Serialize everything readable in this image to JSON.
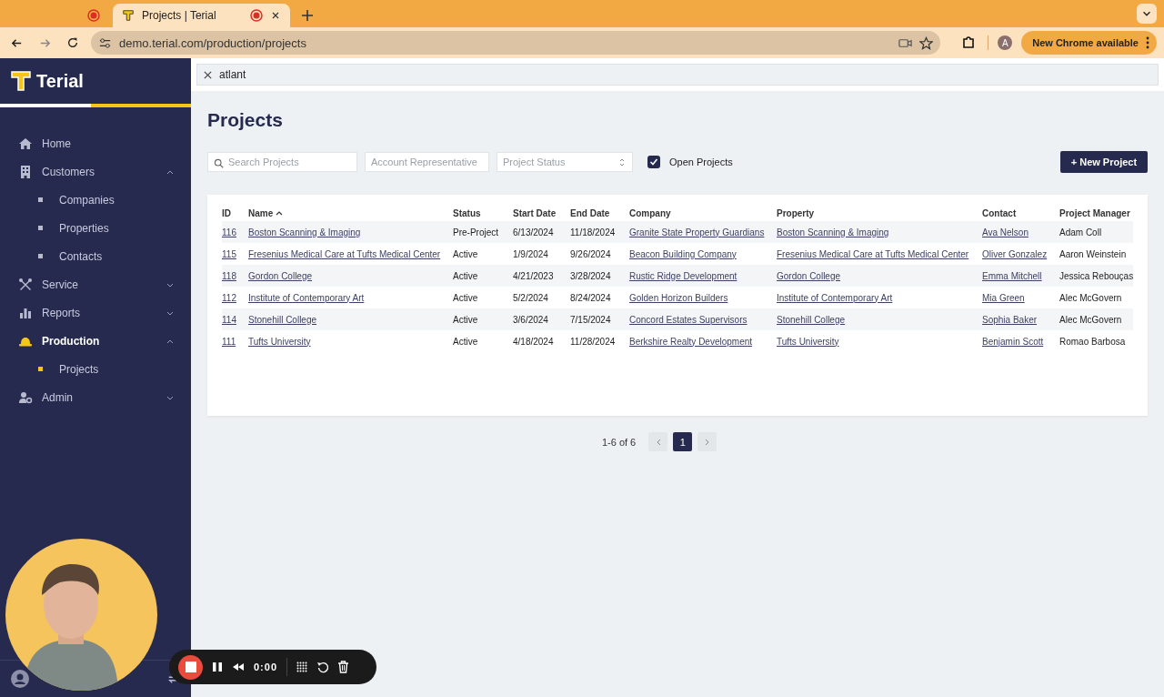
{
  "browser": {
    "tabs": [
      {
        "recording": true,
        "selected": false
      },
      {
        "title": "Projects | Terial",
        "recording": true,
        "selected": true
      }
    ],
    "url": "demo.terial.com/production/projects",
    "profile": "A",
    "update_button": "New Chrome available"
  },
  "sidebar": {
    "logo": "Terial",
    "items": [
      {
        "label": "Home",
        "selected": false
      },
      {
        "label": "Customers",
        "selected": false,
        "expanded": true,
        "children": [
          {
            "label": "Companies",
            "selected": false
          },
          {
            "label": "Properties",
            "selected": false
          },
          {
            "label": "Contacts",
            "selected": false
          }
        ]
      },
      {
        "label": "Service",
        "selected": false,
        "expanded": false
      },
      {
        "label": "Reports",
        "selected": false,
        "expanded": false
      },
      {
        "label": "Production",
        "selected": true,
        "expanded": true,
        "children": [
          {
            "label": "Projects",
            "selected": true
          }
        ]
      },
      {
        "label": "Admin",
        "selected": false,
        "expanded": false
      }
    ]
  },
  "global_search": {
    "value": "atlant"
  },
  "page_title": "Projects",
  "filters": {
    "search_placeholder": "Search Projects",
    "representative_placeholder": "Account Representative",
    "status_placeholder": "Project Status",
    "open_projects": {
      "label": "Open Projects",
      "checked": true
    },
    "new_button": "+ New Project"
  },
  "table": {
    "columns": [
      {
        "label": "ID",
        "sorted": false
      },
      {
        "label": "Name",
        "sorted": true
      },
      {
        "label": "Status",
        "sorted": false
      },
      {
        "label": "Start Date",
        "sorted": false
      },
      {
        "label": "End Date",
        "sorted": false
      },
      {
        "label": "Company",
        "sorted": false
      },
      {
        "label": "Property",
        "sorted": false
      },
      {
        "label": "Contact",
        "sorted": false
      },
      {
        "label": "Project Manager",
        "sorted": false
      }
    ],
    "rows": [
      {
        "id": "116",
        "name": "Boston Scanning & Imaging",
        "status": "Pre-Project",
        "start": "6/13/2024",
        "end": "11/18/2024",
        "company": "Granite State Property Guardians",
        "property": "Boston Scanning & Imaging",
        "contact": "Ava Nelson",
        "manager": "Adam Coll"
      },
      {
        "id": "115",
        "name": "Fresenius Medical Care at Tufts Medical Center",
        "status": "Active",
        "start": "1/9/2024",
        "end": "9/26/2024",
        "company": "Beacon Building Company",
        "property": "Fresenius Medical Care at Tufts Medical Center",
        "contact": "Oliver Gonzalez",
        "manager": "Aaron Weinstein"
      },
      {
        "id": "118",
        "name": "Gordon College",
        "status": "Active",
        "start": "4/21/2023",
        "end": "3/28/2024",
        "company": "Rustic Ridge Development",
        "property": "Gordon College",
        "contact": "Emma Mitchell",
        "manager": "Jessica Rebouças"
      },
      {
        "id": "112",
        "name": "Institute of Contemporary Art",
        "status": "Active",
        "start": "5/2/2024",
        "end": "8/24/2024",
        "company": "Golden Horizon Builders",
        "property": "Institute of Contemporary Art",
        "contact": "Mia Green",
        "manager": "Alec McGovern"
      },
      {
        "id": "114",
        "name": "Stonehill College",
        "status": "Active",
        "start": "3/6/2024",
        "end": "7/15/2024",
        "company": "Concord Estates Supervisors",
        "property": "Stonehill College",
        "contact": "Sophia Baker",
        "manager": "Alec McGovern"
      },
      {
        "id": "111",
        "name": "Tufts University",
        "status": "Active",
        "start": "4/18/2024",
        "end": "11/28/2024",
        "company": "Berkshire Realty Development",
        "property": "Tufts University",
        "contact": "Benjamin Scott",
        "manager": "Romao Barbosa"
      }
    ]
  },
  "pagination": {
    "summary": "1-6 of 6",
    "pages": [
      {
        "label": "1",
        "selected": true
      }
    ]
  },
  "recorder": {
    "time": "0:00"
  }
}
